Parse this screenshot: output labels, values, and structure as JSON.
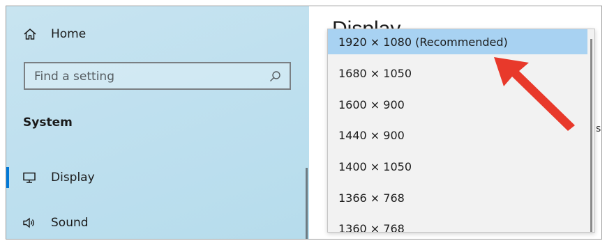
{
  "sidebar": {
    "home_label": "Home",
    "search_placeholder": "Find a setting",
    "section_title": "System",
    "items": [
      {
        "label": "Display",
        "icon": "monitor-icon",
        "active": true
      },
      {
        "label": "Sound",
        "icon": "speaker-icon",
        "active": false
      }
    ]
  },
  "content": {
    "page_title": "Display",
    "bg_glyph": "s"
  },
  "dropdown": {
    "options": [
      "1920 × 1080 (Recommended)",
      "1680 × 1050",
      "1600 × 900",
      "1440 × 900",
      "1400 × 1050",
      "1366 × 768",
      "1360 × 768"
    ],
    "selected_index": 0
  },
  "colors": {
    "accent": "#0078d7",
    "selected_bg": "#a8d2f2",
    "arrow": "#e8392b"
  }
}
